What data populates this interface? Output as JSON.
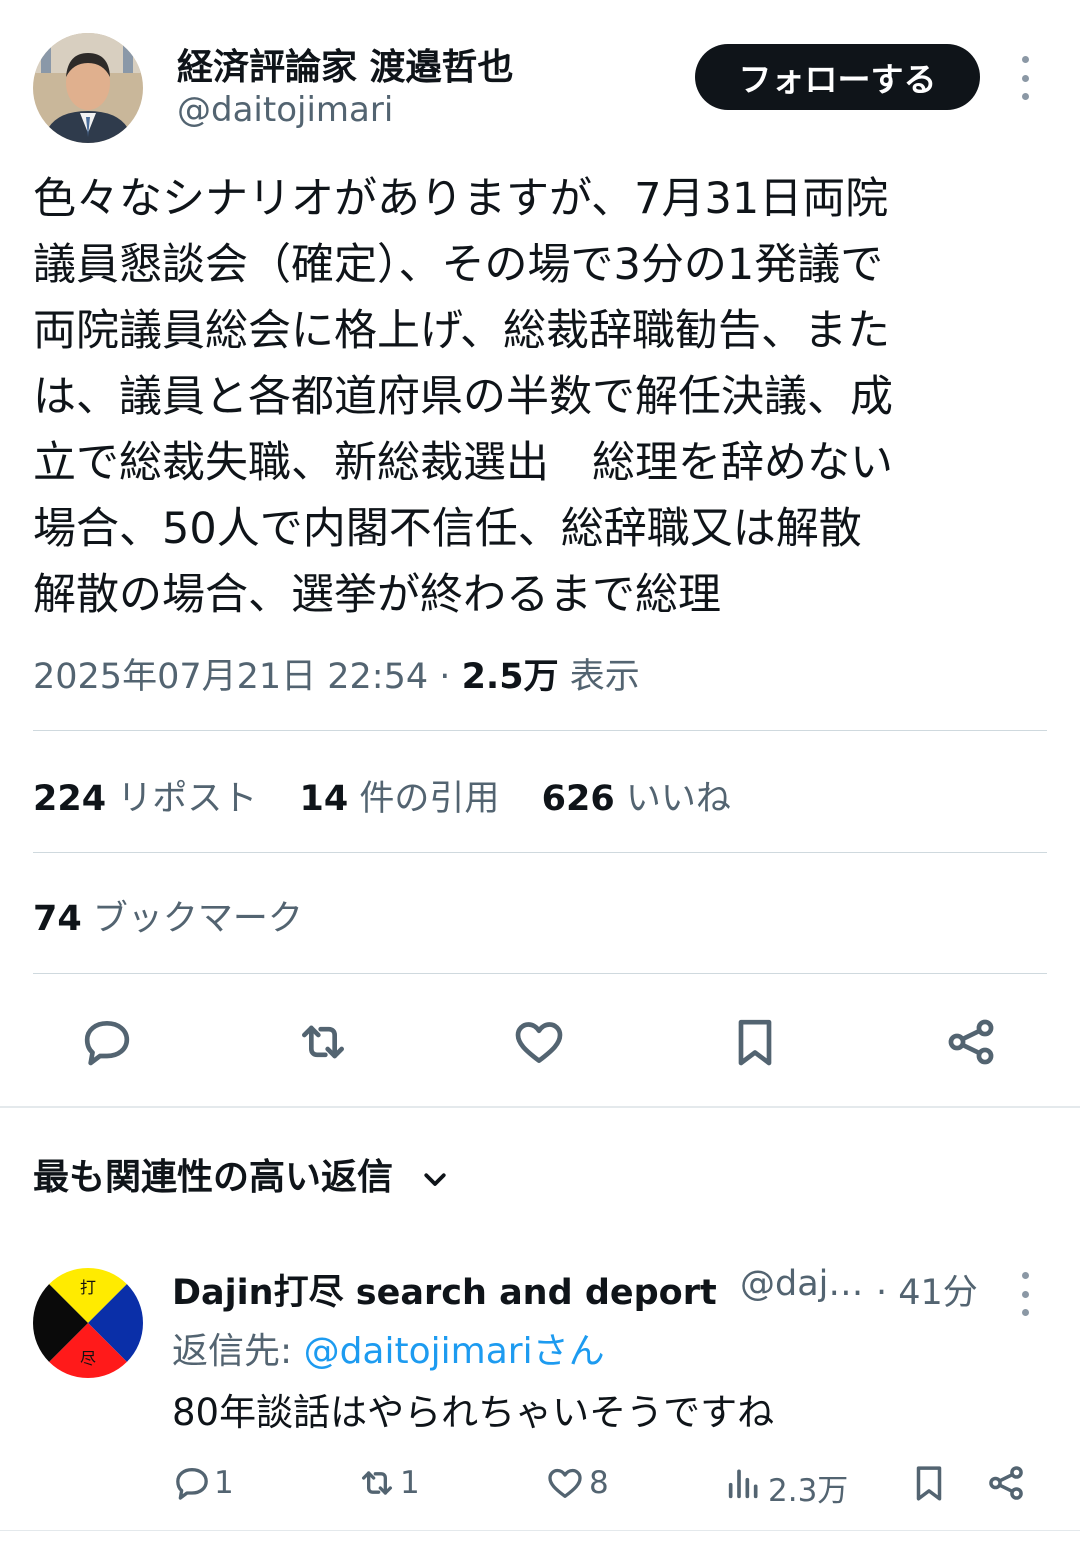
{
  "author": {
    "name": "経済評論家 渡邉哲也",
    "handle": "@daitojimari",
    "follow_label": "フォローする"
  },
  "tweet": {
    "lines": [
      "色々なシナリオがありますが、7月31日両院",
      "議員懇談会（確定）、その場で3分の1発議で",
      "両院議員総会に格上げ、総裁辞職勧告、また",
      "は、議員と各都道府県の半数で解任決議、成",
      "立で総裁失職、新総裁選出　総理を辞めない",
      "場合、50人で内閣不信任、総辞職又は解散",
      "解散の場合、選挙が終わるまで総理"
    ],
    "timestamp": "2025年07月21日 22:54",
    "separator": "·",
    "views_count": "2.5万",
    "views_label": "表示"
  },
  "stats": {
    "reposts_count": "224",
    "reposts_label": "リポスト",
    "quotes_count": "14",
    "quotes_label": "件の引用",
    "likes_count": "626",
    "likes_label": "いいね",
    "bookmarks_count": "74",
    "bookmarks_label": "ブックマーク"
  },
  "actions": [
    "reply-icon",
    "repost-icon",
    "like-icon",
    "bookmark-icon",
    "share-icon"
  ],
  "replies_sort": {
    "label": "最も関連性の高い返信"
  },
  "reply": {
    "avatar_chars": [
      "打",
      "尽"
    ],
    "name": "Dajin打尽 search and deport",
    "handle": "@daj…",
    "time": "· 41分",
    "reply_to_prefix": "返信先: ",
    "reply_to_mention": "@daitojimariさん",
    "text": "80年談話はやられちゃいそうですね",
    "replies": "1",
    "reposts": "1",
    "likes": "8",
    "views": "2.3万"
  },
  "colors": {
    "text": "#0f1419",
    "secondary": "#536471",
    "link": "#1d9bf0",
    "divider": "#cfd9de",
    "follow_bg": "#0f1419"
  }
}
